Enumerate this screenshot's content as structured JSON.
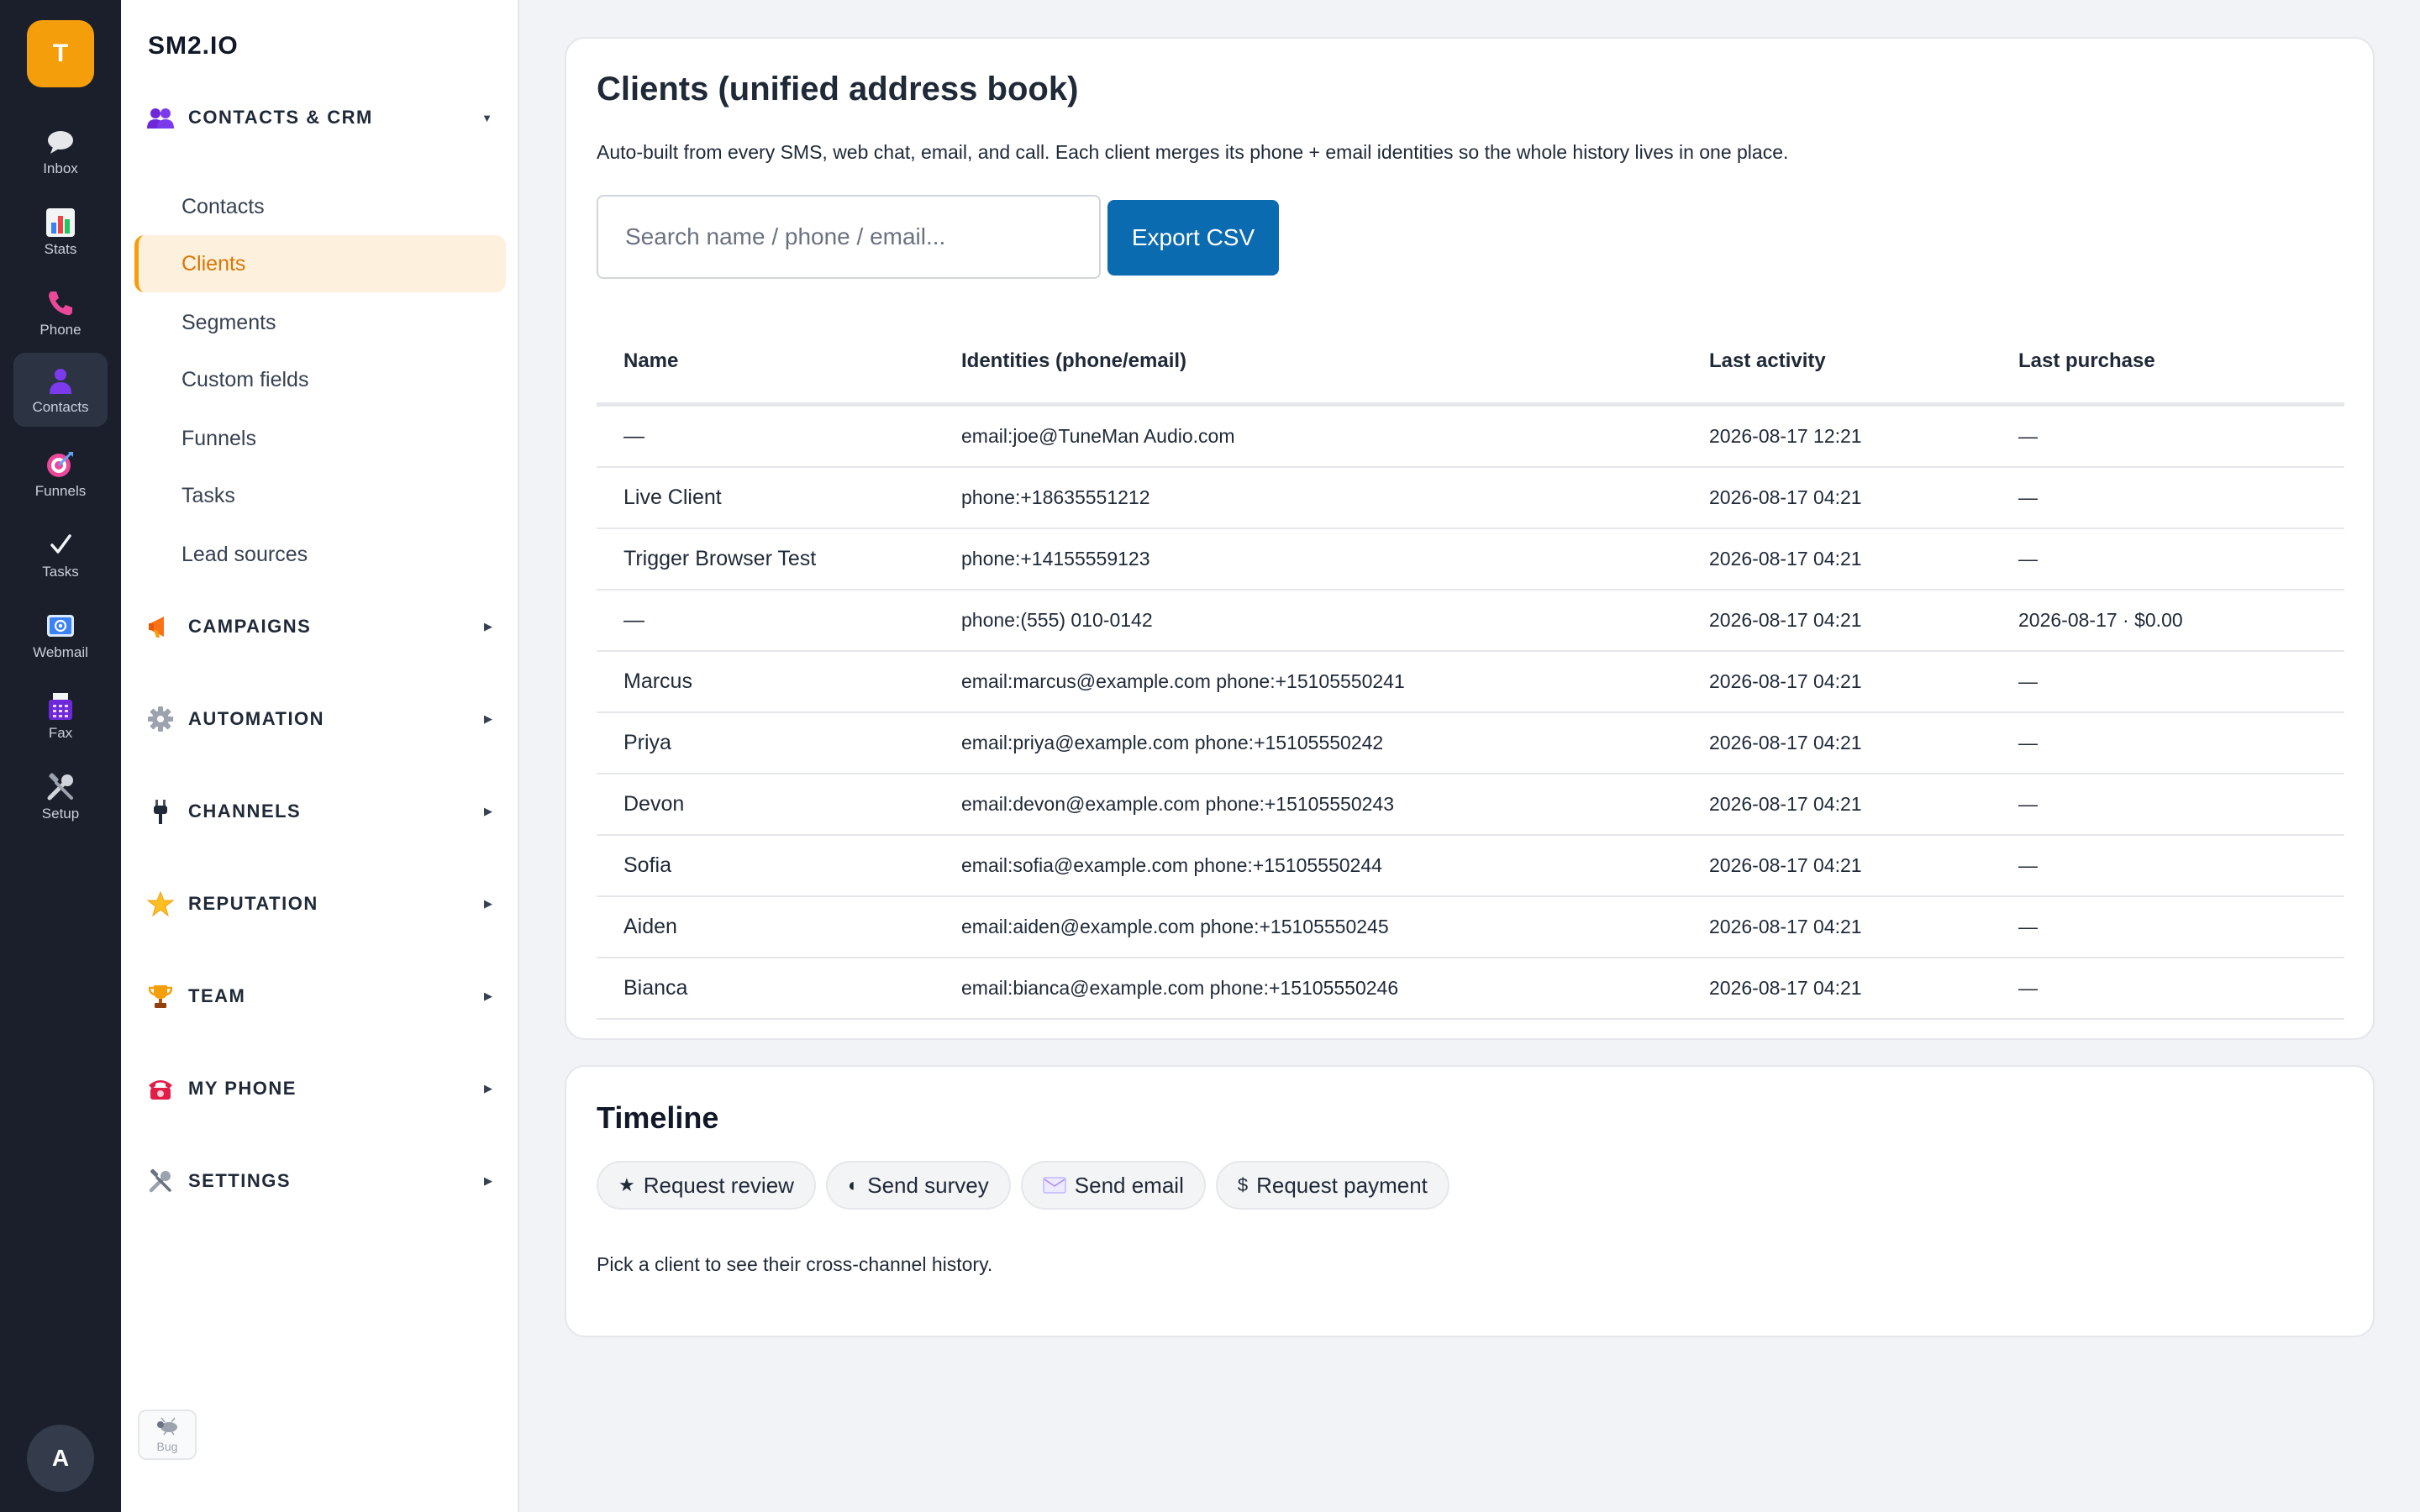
{
  "rail": {
    "logo": "T",
    "items": [
      {
        "label": "Inbox",
        "icon": "speech-bubble-icon"
      },
      {
        "label": "Stats",
        "icon": "bar-chart-icon"
      },
      {
        "label": "Phone",
        "icon": "phone-icon"
      },
      {
        "label": "Contacts",
        "icon": "person-icon"
      },
      {
        "label": "Funnels",
        "icon": "target-icon"
      },
      {
        "label": "Tasks",
        "icon": "checkmark-icon"
      },
      {
        "label": "Webmail",
        "icon": "email-icon"
      },
      {
        "label": "Fax",
        "icon": "fax-icon"
      },
      {
        "label": "Setup",
        "icon": "tools-icon"
      }
    ],
    "active": "Contacts",
    "avatar": "A"
  },
  "sidebar": {
    "brand": "SM2.IO",
    "sections": [
      {
        "label": "CONTACTS & CRM",
        "icon": "people-icon",
        "expanded": true
      },
      {
        "label": "CAMPAIGNS",
        "icon": "megaphone-icon"
      },
      {
        "label": "AUTOMATION",
        "icon": "gear-icon"
      },
      {
        "label": "CHANNELS",
        "icon": "plug-icon"
      },
      {
        "label": "REPUTATION",
        "icon": "star-icon"
      },
      {
        "label": "TEAM",
        "icon": "trophy-icon"
      },
      {
        "label": "MY PHONE",
        "icon": "telephone-icon"
      },
      {
        "label": "SETTINGS",
        "icon": "tools-icon"
      }
    ],
    "items": [
      "Contacts",
      "Clients",
      "Segments",
      "Custom fields",
      "Funnels",
      "Tasks",
      "Lead sources"
    ],
    "active_item": "Clients",
    "bug_label": "Bug"
  },
  "clients": {
    "title": "Clients (unified address book)",
    "description": "Auto-built from every SMS, web chat, email, and call. Each client merges its phone + email identities so the whole history lives in one place.",
    "search_placeholder": "Search name / phone / email...",
    "export_label": "Export CSV",
    "columns": [
      "Name",
      "Identities (phone/email)",
      "Last activity",
      "Last purchase"
    ],
    "rows": [
      [
        "—",
        "email:joe@TuneMan Audio.com",
        "2026-08-17 12:21",
        "—"
      ],
      [
        "Live Client",
        "phone:+18635551212",
        "2026-08-17 04:21",
        "—"
      ],
      [
        "Trigger Browser Test",
        "phone:+14155559123",
        "2026-08-17 04:21",
        "—"
      ],
      [
        "—",
        "phone:(555) 010-0142",
        "2026-08-17 04:21",
        "2026-08-17 · $0.00"
      ],
      [
        "Marcus",
        "email:marcus@example.com phone:+15105550241",
        "2026-08-17 04:21",
        "—"
      ],
      [
        "Priya",
        "email:priya@example.com phone:+15105550242",
        "2026-08-17 04:21",
        "—"
      ],
      [
        "Devon",
        "email:devon@example.com phone:+15105550243",
        "2026-08-17 04:21",
        "—"
      ],
      [
        "Sofia",
        "email:sofia@example.com phone:+15105550244",
        "2026-08-17 04:21",
        "—"
      ],
      [
        "Aiden",
        "email:aiden@example.com phone:+15105550245",
        "2026-08-17 04:21",
        "—"
      ],
      [
        "Bianca",
        "email:bianca@example.com phone:+15105550246",
        "2026-08-17 04:21",
        "—"
      ]
    ]
  },
  "timeline": {
    "title": "Timeline",
    "actions": [
      {
        "label": "Request review",
        "icon": "star-icon",
        "glyph": "★"
      },
      {
        "label": "Send survey",
        "icon": "half-circle-icon",
        "glyph": "◐"
      },
      {
        "label": "Send email",
        "icon": "envelope-icon",
        "glyph": ""
      },
      {
        "label": "Request payment",
        "icon": "dollar-icon",
        "glyph": "$"
      }
    ],
    "hint": "Pick a client to see their cross-channel history."
  },
  "colors": {
    "rail_bg": "#1a1f2b",
    "brand_accent": "#f59e0b",
    "active_item_bg": "#fdf0dc",
    "active_item_text": "#d97706",
    "primary_button": "#0b6bb0"
  }
}
